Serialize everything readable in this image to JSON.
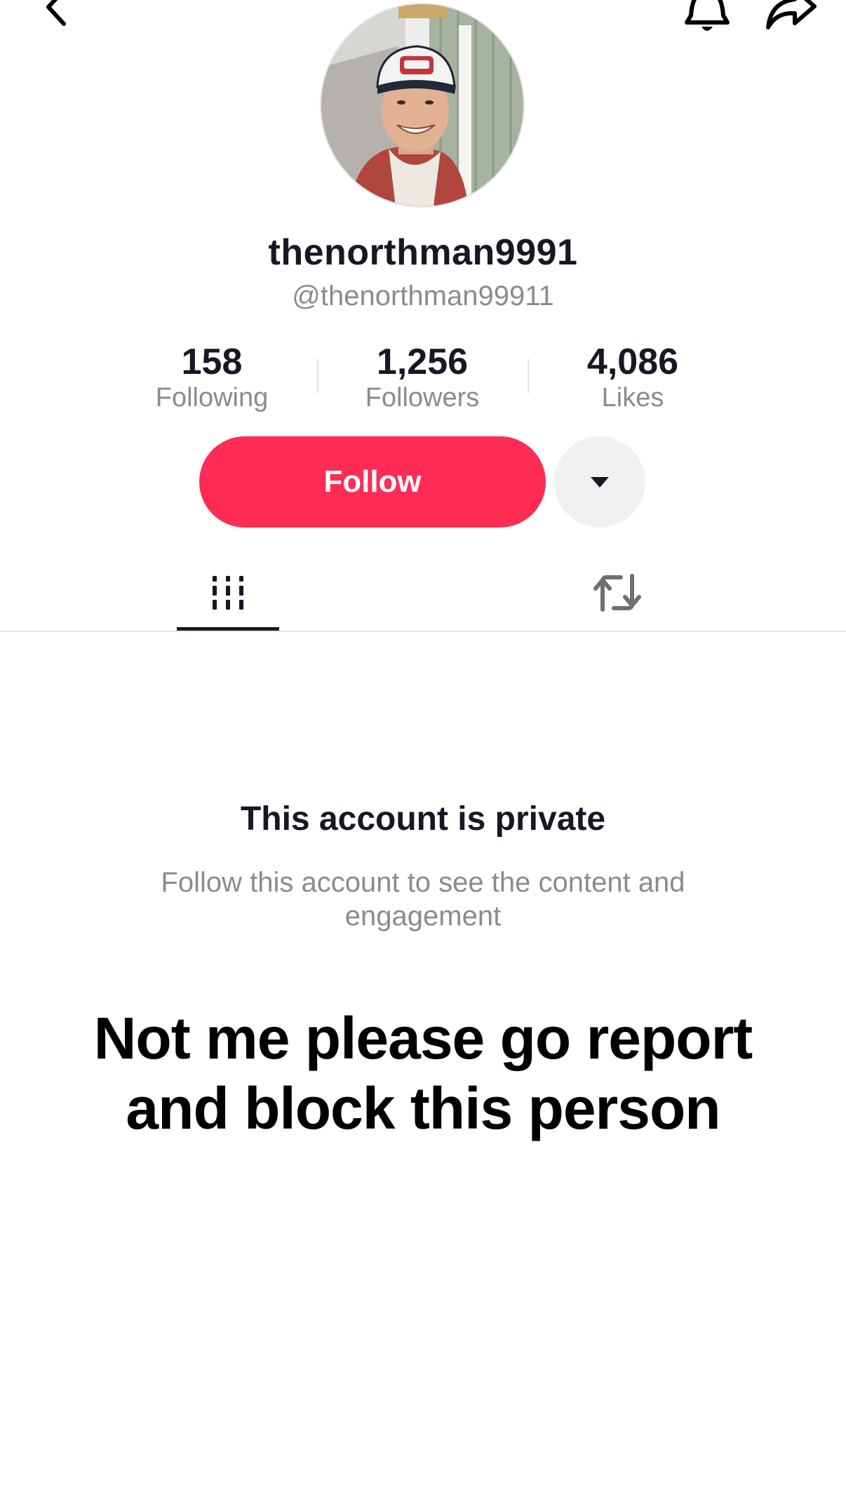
{
  "nav": {
    "back_icon": "chevron-left-icon",
    "bell_icon": "bell-icon",
    "share_icon": "share-arrow-icon"
  },
  "profile": {
    "display_name": "thenorthman9991",
    "handle": "@thenorthman99911",
    "avatar_icon": "profile-photo"
  },
  "stats": [
    {
      "value": "158",
      "label": "Following"
    },
    {
      "value": "1,256",
      "label": "Followers"
    },
    {
      "value": "4,086",
      "label": "Likes"
    }
  ],
  "actions": {
    "follow_label": "Follow",
    "more_icon": "caret-down-icon",
    "follow_color": "#fe2c55"
  },
  "tabs": [
    {
      "name": "videos",
      "icon": "grid-bars-icon",
      "selected": true
    },
    {
      "name": "reposts",
      "icon": "repost-icon",
      "selected": false
    }
  ],
  "private": {
    "title": "This account is private",
    "description": "Follow this account to see the content and engagement"
  },
  "caption": {
    "text": "Not me please go report and block this person"
  }
}
